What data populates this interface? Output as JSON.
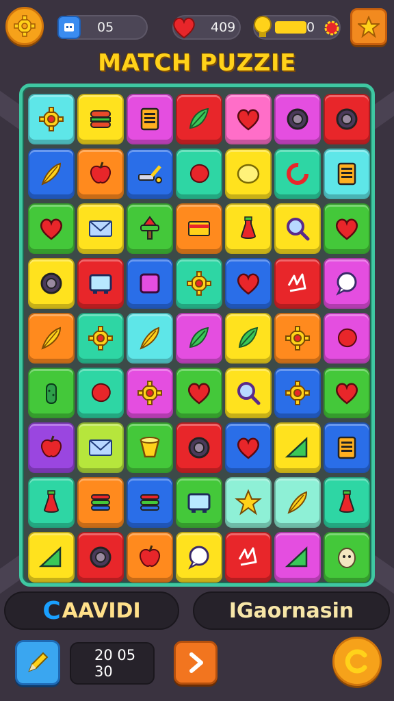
{
  "header": {
    "gems_value": "05",
    "hearts_value": "409",
    "coins_value": "0"
  },
  "title": "MATCH PUZZIE",
  "colors": {
    "cyan": "#5ee6e8",
    "yellow": "#ffe21e",
    "magenta": "#e44ee0",
    "red": "#e8262a",
    "pink": "#ff6ec8",
    "purple": "#9a46e0",
    "blue": "#2a6ee8",
    "orange": "#ff8a1e",
    "teal": "#2ed6a4",
    "green": "#44c83a",
    "mint": "#8ef0d6",
    "lime": "#b6e63c"
  },
  "board": [
    [
      {
        "c": "cyan",
        "i": "gear-icon"
      },
      {
        "c": "yellow",
        "i": "burger-icon"
      },
      {
        "c": "magenta",
        "i": "tablet-icon"
      },
      {
        "c": "red",
        "i": "leaf-icon"
      },
      {
        "c": "pink",
        "i": "heart-icon"
      },
      {
        "c": "magenta",
        "i": "ring-icon"
      },
      {
        "c": "red",
        "i": "ring-icon"
      }
    ],
    [
      {
        "c": "blue",
        "i": "feather-icon"
      },
      {
        "c": "orange",
        "i": "apple-icon"
      },
      {
        "c": "blue",
        "i": "tool-icon"
      },
      {
        "c": "teal",
        "i": "blob-icon"
      },
      {
        "c": "yellow",
        "i": "lemon-icon"
      },
      {
        "c": "teal",
        "i": "swirl-icon"
      },
      {
        "c": "cyan",
        "i": "tablet-icon"
      }
    ],
    [
      {
        "c": "green",
        "i": "heart-icon"
      },
      {
        "c": "yellow",
        "i": "envelope-icon"
      },
      {
        "c": "green",
        "i": "tree-icon"
      },
      {
        "c": "orange",
        "i": "card-icon"
      },
      {
        "c": "yellow",
        "i": "bottle-icon"
      },
      {
        "c": "yellow",
        "i": "magnifier-icon"
      },
      {
        "c": "green",
        "i": "heart-icon"
      }
    ],
    [
      {
        "c": "yellow",
        "i": "ring-icon"
      },
      {
        "c": "red",
        "i": "tv-icon"
      },
      {
        "c": "blue",
        "i": "square-icon"
      },
      {
        "c": "teal",
        "i": "gear-icon"
      },
      {
        "c": "blue",
        "i": "heart-icon"
      },
      {
        "c": "red",
        "i": "scribble-icon"
      },
      {
        "c": "magenta",
        "i": "bubble-icon"
      }
    ],
    [
      {
        "c": "orange",
        "i": "feather-icon"
      },
      {
        "c": "teal",
        "i": "gear-icon"
      },
      {
        "c": "cyan",
        "i": "feather-icon"
      },
      {
        "c": "magenta",
        "i": "leaf-icon"
      },
      {
        "c": "yellow",
        "i": "leaf-icon"
      },
      {
        "c": "orange",
        "i": "gear-icon"
      },
      {
        "c": "magenta",
        "i": "blob-icon"
      }
    ],
    [
      {
        "c": "green",
        "i": "cactus-icon"
      },
      {
        "c": "teal",
        "i": "blob-icon"
      },
      {
        "c": "magenta",
        "i": "gear-icon"
      },
      {
        "c": "green",
        "i": "heart-icon"
      },
      {
        "c": "yellow",
        "i": "magnifier-icon"
      },
      {
        "c": "blue",
        "i": "gear-icon"
      },
      {
        "c": "green",
        "i": "heart-icon"
      }
    ],
    [
      {
        "c": "purple",
        "i": "apple-icon"
      },
      {
        "c": "lime",
        "i": "envelope-icon"
      },
      {
        "c": "green",
        "i": "cup-icon"
      },
      {
        "c": "red",
        "i": "ring-icon"
      },
      {
        "c": "blue",
        "i": "heart-icon"
      },
      {
        "c": "yellow",
        "i": "triangle-icon"
      },
      {
        "c": "blue",
        "i": "tablet-icon"
      }
    ],
    [
      {
        "c": "teal",
        "i": "bottle-icon"
      },
      {
        "c": "orange",
        "i": "stack-icon"
      },
      {
        "c": "blue",
        "i": "stack-icon"
      },
      {
        "c": "green",
        "i": "tv-icon"
      },
      {
        "c": "mint",
        "i": "star-icon"
      },
      {
        "c": "mint",
        "i": "feather-icon"
      },
      {
        "c": "teal",
        "i": "bottle-icon"
      }
    ],
    [
      {
        "c": "yellow",
        "i": "triangle-icon"
      },
      {
        "c": "red",
        "i": "ring-icon"
      },
      {
        "c": "orange",
        "i": "apple-icon"
      },
      {
        "c": "yellow",
        "i": "bubble-icon"
      },
      {
        "c": "red",
        "i": "scribble-icon"
      },
      {
        "c": "magenta",
        "i": "triangle-icon"
      },
      {
        "c": "green",
        "i": "face-icon"
      }
    ]
  ],
  "bottom": {
    "left_glyph": "C",
    "left_label": "AAVIDI",
    "right_label": "IGaornasin",
    "timer_line1": "20 05",
    "timer_line2": "30"
  }
}
